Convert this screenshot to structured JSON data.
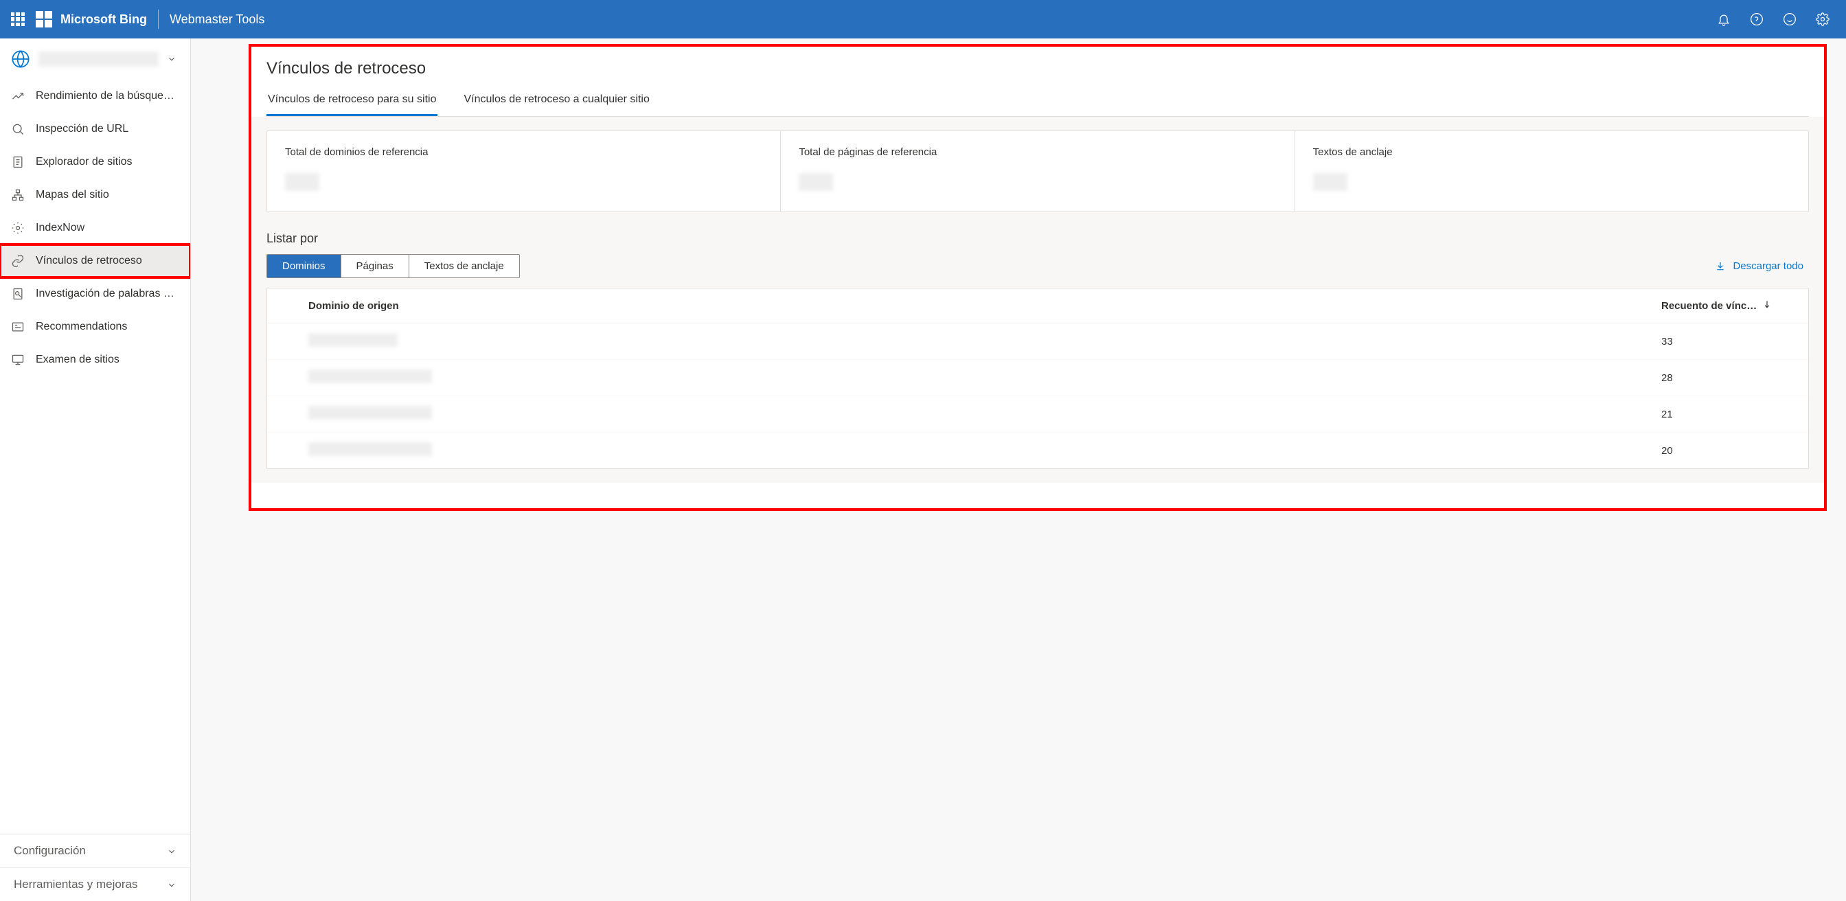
{
  "header": {
    "brand": "Microsoft Bing",
    "product": "Webmaster Tools"
  },
  "sidebar": {
    "site_name": "",
    "items": [
      {
        "id": "performance",
        "label": "Rendimiento de la búsque…"
      },
      {
        "id": "url-inspection",
        "label": "Inspección de URL"
      },
      {
        "id": "site-explorer",
        "label": "Explorador de sitios"
      },
      {
        "id": "sitemaps",
        "label": "Mapas del sitio"
      },
      {
        "id": "indexnow",
        "label": "IndexNow"
      },
      {
        "id": "backlinks",
        "label": "Vínculos de retroceso"
      },
      {
        "id": "keyword-research",
        "label": "Investigación de palabras …"
      },
      {
        "id": "recommendations",
        "label": "Recommendations"
      },
      {
        "id": "site-scan",
        "label": "Examen de sitios"
      }
    ],
    "footer": [
      {
        "id": "configuration",
        "label": "Configuración"
      },
      {
        "id": "tools",
        "label": "Herramientas y mejoras"
      }
    ]
  },
  "main": {
    "title": "Vínculos de retroceso",
    "tabs": [
      {
        "id": "your-site",
        "label": "Vínculos de retroceso para su sitio",
        "active": true
      },
      {
        "id": "any-site",
        "label": "Vínculos de retroceso a cualquier sitio",
        "active": false
      }
    ],
    "stats": [
      {
        "label": "Total de dominios de referencia",
        "value": ""
      },
      {
        "label": "Total de páginas de referencia",
        "value": ""
      },
      {
        "label": "Textos de anclaje",
        "value": ""
      }
    ],
    "list_by_label": "Listar por",
    "segments": [
      {
        "id": "domains",
        "label": "Dominios",
        "active": true
      },
      {
        "id": "pages",
        "label": "Páginas",
        "active": false
      },
      {
        "id": "anchors",
        "label": "Textos de anclaje",
        "active": false
      }
    ],
    "download_label": "Descargar todo",
    "table": {
      "col_domain": "Dominio de origen",
      "col_count": "Recuento de vínc…",
      "rows": [
        {
          "domain": "",
          "width": 130,
          "count": "33"
        },
        {
          "domain": "",
          "width": 180,
          "count": "28"
        },
        {
          "domain": "",
          "width": 180,
          "count": "21"
        },
        {
          "domain": "",
          "width": 180,
          "count": "20"
        }
      ]
    }
  }
}
